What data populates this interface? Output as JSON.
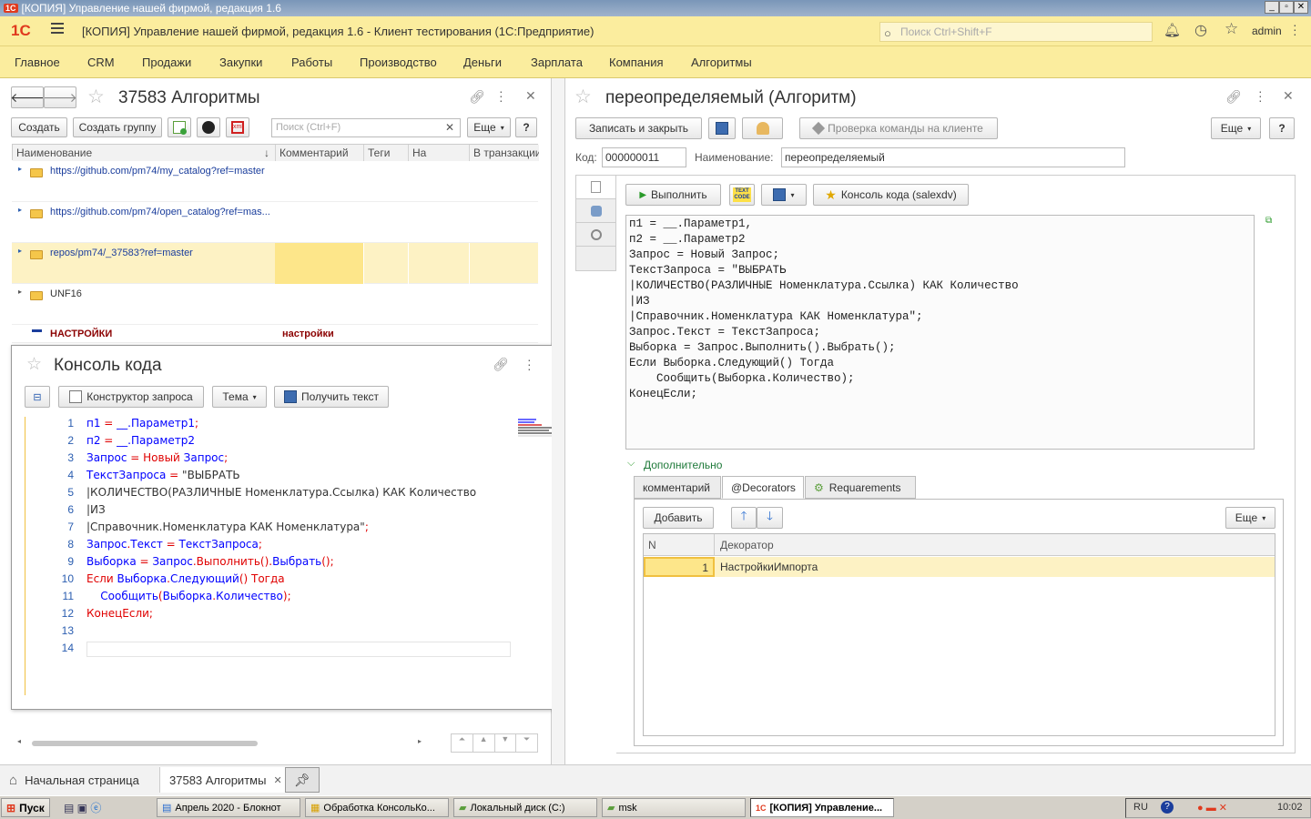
{
  "window": {
    "title": "[КОПИЯ] Управление нашей фирмой, редакция 1.6"
  },
  "header": {
    "app_title": "[КОПИЯ] Управление нашей фирмой, редакция 1.6  - Клиент тестирования (1С:Предприятие)",
    "search_placeholder": "Поиск Ctrl+Shift+F",
    "user": "admin"
  },
  "sections": [
    "Главное",
    "CRM",
    "Продажи",
    "Закупки",
    "Работы",
    "Производство",
    "Деньги",
    "Зарплата",
    "Компания",
    "Алгоритмы"
  ],
  "left_form": {
    "title": "37583 Алгоритмы",
    "create": "Создать",
    "create_group": "Создать группу",
    "search_placeholder": "Поиск (Ctrl+F)",
    "more": "Еще",
    "help": "?",
    "columns": [
      "Наименование",
      "Комментарий",
      "Теги",
      "На клиенте",
      "В транзакции"
    ],
    "rows": [
      {
        "name": "https://github.com/pm74/my_catalog?ref=master",
        "comment": ""
      },
      {
        "name": "https://github.com/pm74/open_catalog?ref=mas...",
        "comment": ""
      },
      {
        "name": "repos/pm74/_37583?ref=master",
        "comment": ""
      },
      {
        "name": "UNF16",
        "comment": ""
      },
      {
        "name": "НАСТРОЙКИ",
        "comment": "настройки"
      }
    ]
  },
  "console": {
    "title": "Консоль кода",
    "query_builder": "Конструктор запроса",
    "theme": "Тема",
    "get_text": "Получить текст",
    "lines": [
      [
        [
          "id",
          "п1 "
        ],
        [
          "kw",
          "= "
        ],
        [
          "id",
          "__."
        ],
        [
          "id",
          "Параметр1"
        ],
        [
          "kw",
          ";"
        ]
      ],
      [
        [
          "id",
          "п2 "
        ],
        [
          "kw",
          "= "
        ],
        [
          "id",
          "__."
        ],
        [
          "id",
          "Параметр2"
        ]
      ],
      [
        [
          "id",
          "Запрос "
        ],
        [
          "kw",
          "= "
        ],
        [
          "kw",
          "Новый "
        ],
        [
          "id",
          "Запрос"
        ],
        [
          "kw",
          ";"
        ]
      ],
      [
        [
          "id",
          "ТекстЗапроса "
        ],
        [
          "kw",
          "= "
        ],
        [
          "tx",
          "\"ВЫБРАТЬ"
        ]
      ],
      [
        [
          "tx",
          "|КОЛИЧЕСТВО(РАЗЛИЧНЫЕ Номенклатура.Ссылка) КАК Количество"
        ]
      ],
      [
        [
          "tx",
          "|ИЗ"
        ]
      ],
      [
        [
          "tx",
          "|Справочник.Номенклатура КАК Номенклатура\""
        ],
        [
          "kw",
          ";"
        ]
      ],
      [
        [
          "id",
          "Запрос"
        ],
        [
          "kw",
          "."
        ],
        [
          "id",
          "Текст "
        ],
        [
          "kw",
          "= "
        ],
        [
          "id",
          "ТекстЗапроса"
        ],
        [
          "kw",
          ";"
        ]
      ],
      [
        [
          "id",
          "Выборка "
        ],
        [
          "kw",
          "= "
        ],
        [
          "id",
          "Запрос"
        ],
        [
          "kw",
          "."
        ],
        [
          "kw",
          "Выполнить"
        ],
        [
          "kw",
          "()."
        ],
        [
          "id",
          "Выбрать"
        ],
        [
          "kw",
          "();"
        ]
      ],
      [
        [
          "kw",
          "Если "
        ],
        [
          "id",
          "Выборка"
        ],
        [
          "kw",
          "."
        ],
        [
          "id",
          "Следующий"
        ],
        [
          "kw",
          "() "
        ],
        [
          "kw",
          "Тогда"
        ]
      ],
      [
        [
          "tx",
          "    "
        ],
        [
          "id",
          "Сообщить"
        ],
        [
          "kw",
          "("
        ],
        [
          "id",
          "Выборка"
        ],
        [
          "kw",
          "."
        ],
        [
          "id",
          "Количество"
        ],
        [
          "kw",
          ");"
        ]
      ],
      [
        [
          "kw",
          "КонецЕсли"
        ],
        [
          "kw",
          ";"
        ]
      ],
      [],
      []
    ]
  },
  "right_form": {
    "title": "переопределяемый (Алгоритм)",
    "save_close": "Записать и закрыть",
    "check_cmd": "Проверка команды на клиенте",
    "more": "Еще",
    "help": "?",
    "code_label": "Код:",
    "code_value": "000000011",
    "name_label": "Наименование:",
    "name_value": "переопределяемый",
    "run": "Выполнить",
    "console_btn": "Консоль кода (salexdv)",
    "code_text": [
      "п1 = __.Параметр1,",
      "п2 = __.Параметр2",
      "Запрос = Новый Запрос;",
      "ТекстЗапроса = \"ВЫБРАТЬ",
      "|КОЛИЧЕСТВО(РАЗЛИЧНЫЕ Номенклатура.Ссылка) КАК Количество",
      "|ИЗ",
      "|Справочник.Номенклатура КАК Номенклатура\";",
      "Запрос.Текст = ТекстЗапроса;",
      "Выборка = Запрос.Выполнить().Выбрать();",
      "Если Выборка.Следующий() Тогда",
      "    Сообщить(Выборка.Количество);",
      "КонецЕсли;"
    ],
    "extra": "Дополнительно",
    "tabs": [
      "комментарий",
      "@Decorators",
      "Requarements"
    ],
    "add": "Добавить",
    "more2": "Еще",
    "table_cols": [
      "N",
      "Декоратор"
    ],
    "table_rows": [
      {
        "n": "1",
        "decorator": "НастройкиИмпорта"
      }
    ]
  },
  "bottom_tabs": [
    "Начальная страница",
    "37583 Алгоритмы"
  ],
  "taskbar": {
    "start": "Пуск",
    "items": [
      "Апрель 2020 - Блокнот",
      "Обработка КонсольКо...",
      "Локальный диск (C:)",
      "msk",
      "[КОПИЯ] Управление..."
    ],
    "lang": "RU",
    "clock": "10:02"
  },
  "colors": {
    "accent_yellow": "#fbed9e",
    "highlight_row": "#fdf2c4",
    "keyword": "#e00000",
    "identifier": "#0000ff"
  }
}
